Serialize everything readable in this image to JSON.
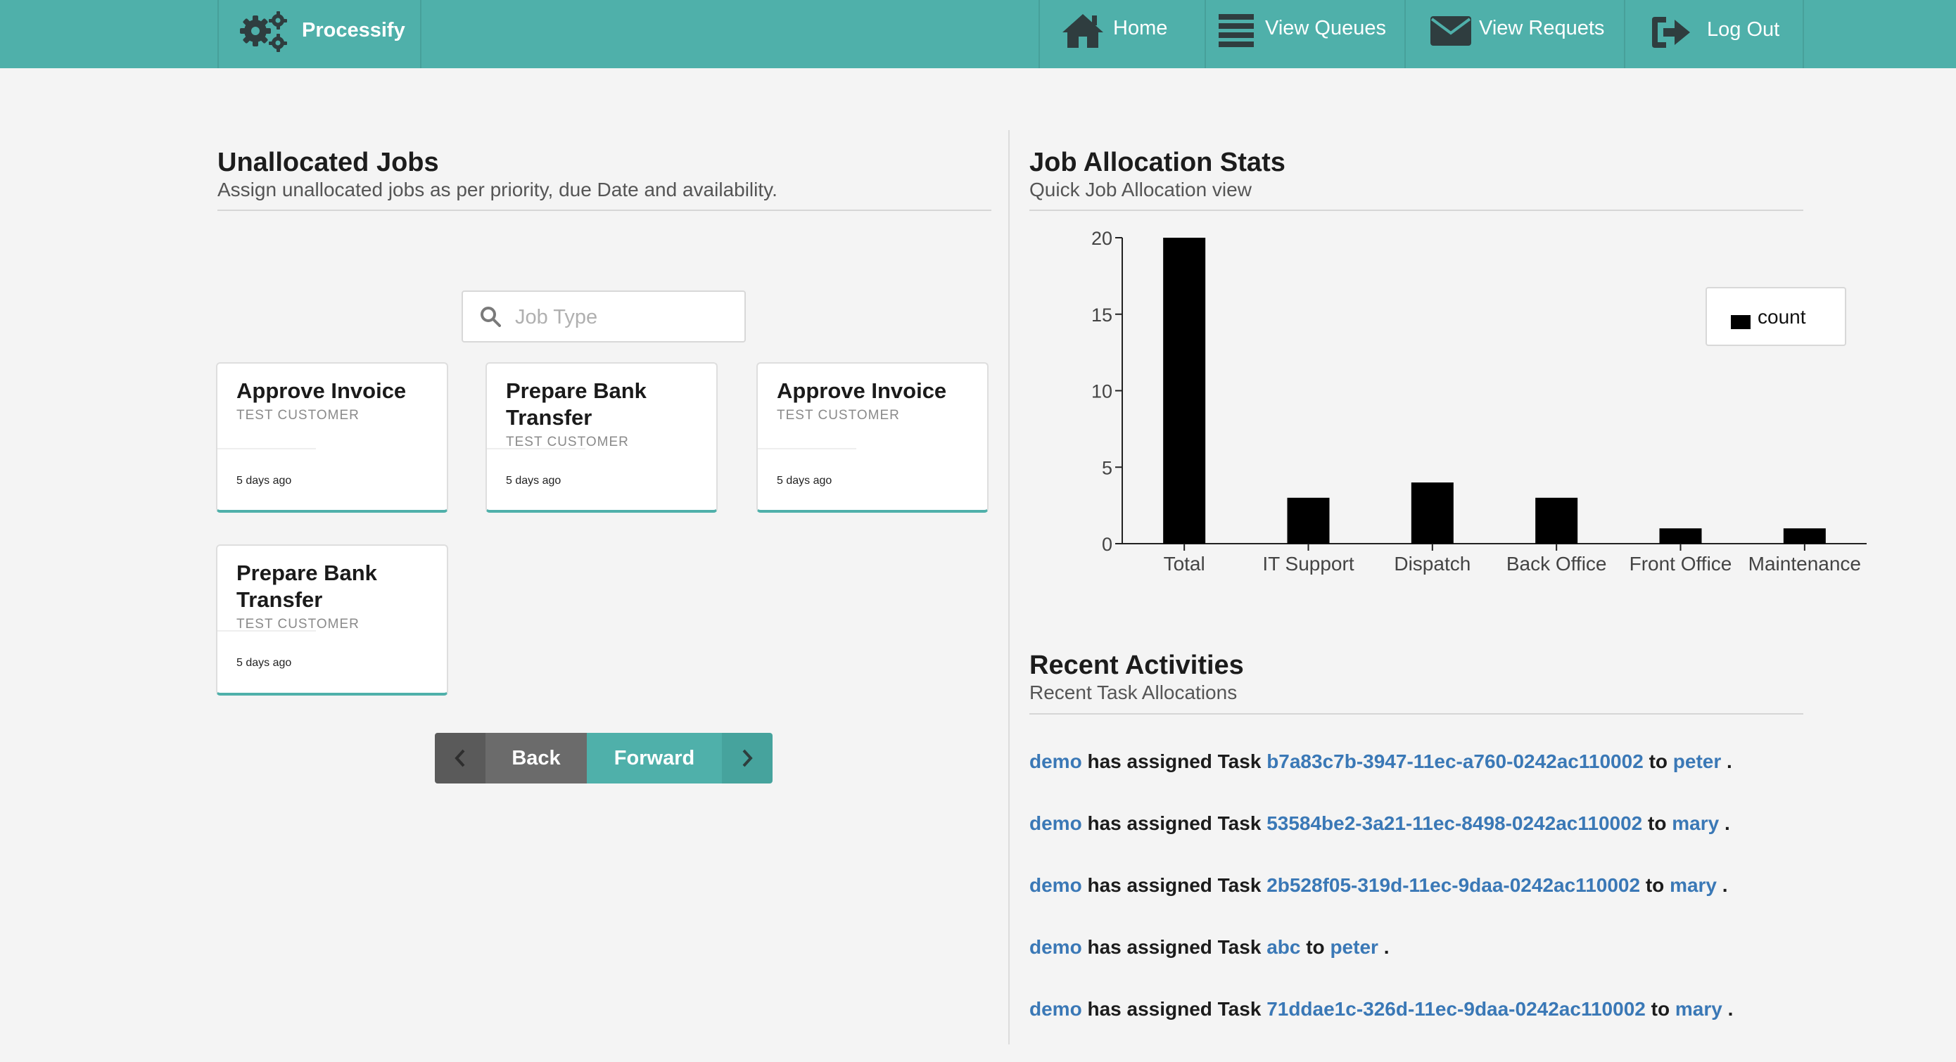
{
  "brand": {
    "name": "Processify",
    "icon": "gears-icon"
  },
  "nav": [
    {
      "label": "Home",
      "icon": "home-icon"
    },
    {
      "label": "View Queues",
      "icon": "menu-icon"
    },
    {
      "label": "View Requets",
      "icon": "envelope-icon"
    },
    {
      "label": "Log Out",
      "icon": "logout-icon"
    }
  ],
  "left": {
    "title": "Unallocated Jobs",
    "subtitle": "Assign unallocated jobs as per priority, due Date and availability.",
    "search": {
      "placeholder": "Job Type",
      "icon": "search-icon"
    },
    "cards": [
      {
        "title": "Approve Invoice",
        "customer": "TEST CUSTOMER",
        "age": "5 days ago"
      },
      {
        "title": "Prepare Bank Transfer",
        "customer": "TEST CUSTOMER",
        "age": "5 days ago"
      },
      {
        "title": "Approve Invoice",
        "customer": "TEST CUSTOMER",
        "age": "5 days ago"
      },
      {
        "title": "Prepare Bank Transfer",
        "customer": "TEST CUSTOMER",
        "age": "5 days ago"
      }
    ],
    "pager": {
      "back": "Back",
      "forward": "Forward"
    }
  },
  "right": {
    "stats_title": "Job Allocation Stats",
    "stats_subtitle": "Quick Job Allocation view",
    "activities_title": "Recent Activities",
    "activities_subtitle": "Recent Task Allocations",
    "activities": [
      {
        "actor": "demo",
        "verb": "has assigned Task",
        "task": "b7a83c7b-3947-11ec-a760-0242ac110002",
        "to": "to",
        "assignee": "peter",
        "end": "."
      },
      {
        "actor": "demo",
        "verb": "has assigned Task",
        "task": "53584be2-3a21-11ec-8498-0242ac110002",
        "to": "to",
        "assignee": "mary",
        "end": "."
      },
      {
        "actor": "demo",
        "verb": "has assigned Task",
        "task": "2b528f05-319d-11ec-9daa-0242ac110002",
        "to": "to",
        "assignee": "mary",
        "end": "."
      },
      {
        "actor": "demo",
        "verb": "has assigned Task",
        "task": "abc",
        "to": "to",
        "assignee": "peter",
        "end": "."
      },
      {
        "actor": "demo",
        "verb": "has assigned Task",
        "task": "71ddae1c-326d-11ec-9daa-0242ac110002",
        "to": "to",
        "assignee": "mary",
        "end": "."
      }
    ]
  },
  "colors": {
    "brand": "#4fb0aa",
    "link": "#3a78b6",
    "bar": "#000000",
    "back_button": "#6b6b6b"
  },
  "chart_data": {
    "type": "bar",
    "categories": [
      "Total",
      "IT Support",
      "Dispatch",
      "Back Office",
      "Front Office",
      "Maintenance"
    ],
    "series": [
      {
        "name": "count",
        "values": [
          20,
          3,
          4,
          3,
          1,
          1
        ]
      }
    ],
    "yticks": [
      0,
      5,
      10,
      15,
      20
    ],
    "ylim": [
      0,
      20
    ],
    "legend": "top-right",
    "grid": false
  }
}
